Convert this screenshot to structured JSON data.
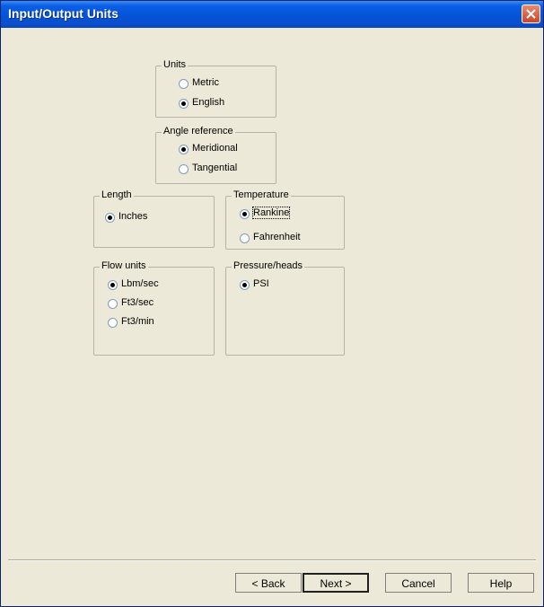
{
  "window": {
    "title": "Input/Output Units"
  },
  "groups": {
    "units": {
      "title": "Units",
      "options": [
        "Metric",
        "English"
      ],
      "selected": "English"
    },
    "angle": {
      "title": "Angle reference",
      "options": [
        "Meridional",
        "Tangential"
      ],
      "selected": "Meridional"
    },
    "length": {
      "title": "Length",
      "options": [
        "Inches"
      ],
      "selected": "Inches"
    },
    "temperature": {
      "title": "Temperature",
      "options": [
        "Rankine",
        "Fahrenheit"
      ],
      "selected": "Rankine"
    },
    "flow": {
      "title": "Flow units",
      "options": [
        "Lbm/sec",
        "Ft3/sec",
        "Ft3/min"
      ],
      "selected": "Lbm/sec"
    },
    "pressure": {
      "title": "Pressure/heads",
      "options": [
        "PSI"
      ],
      "selected": "PSI"
    }
  },
  "buttons": {
    "back": "< Back",
    "next": "Next >",
    "cancel": "Cancel",
    "help": "Help"
  },
  "colors": {
    "titlebar": "#0553d8",
    "dialog_bg": "#ece9d8",
    "close_button": "#c9452b"
  }
}
